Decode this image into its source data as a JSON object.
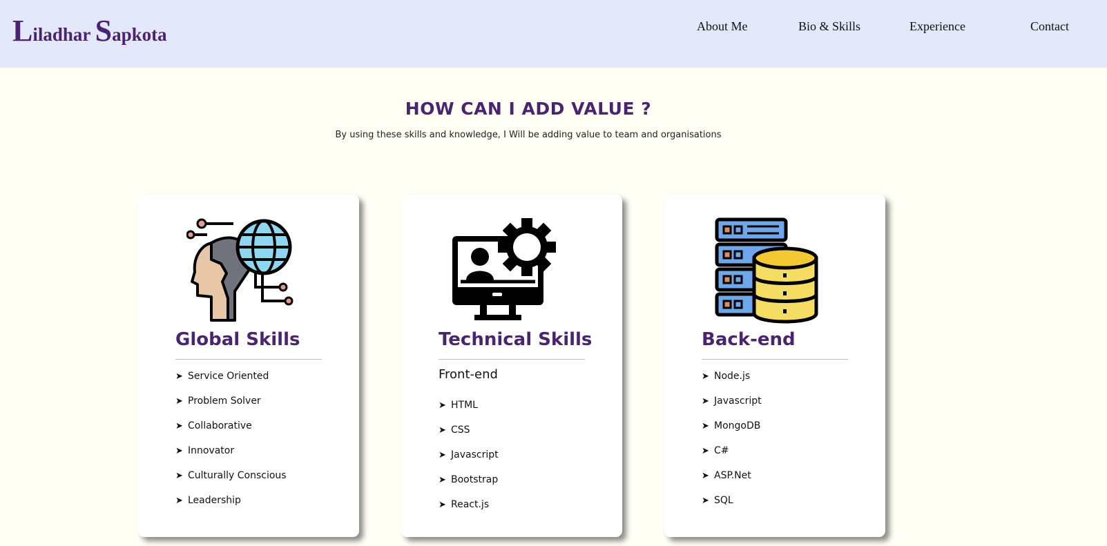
{
  "header": {
    "brand": {
      "first_initial": "L",
      "first_rest": "iladhar",
      "last_initial": "S",
      "last_rest": "apkota"
    },
    "nav": [
      "About Me",
      "Bio & Skills",
      "Experience",
      "Contact"
    ]
  },
  "section": {
    "heading": "HOW CAN I ADD VALUE ?",
    "subheading": "By using these skills and knowledge, I Will be adding value to team and organisations"
  },
  "cards": [
    {
      "icon": "global-skills-icon",
      "title": "Global Skills",
      "items": [
        "Service Oriented",
        "Problem Solver",
        "Collaborative",
        "Innovator",
        "Culturally Conscious",
        "Leadership"
      ]
    },
    {
      "icon": "technical-skills-icon",
      "title": "Technical Skills",
      "subtitle": "Front-end",
      "items": [
        "HTML",
        "CSS",
        "Javascript",
        "Bootstrap",
        "React.js"
      ]
    },
    {
      "icon": "database-server-icon",
      "title": "Back-end",
      "items": [
        "Node.js",
        "Javascript",
        "MongoDB",
        "C#",
        "ASP.Net",
        "SQL"
      ]
    }
  ],
  "list_marker": "➤",
  "colors": {
    "header_bg": "#e3e8fb",
    "page_bg": "#fffff6",
    "accent_purple": "#4a2470"
  }
}
